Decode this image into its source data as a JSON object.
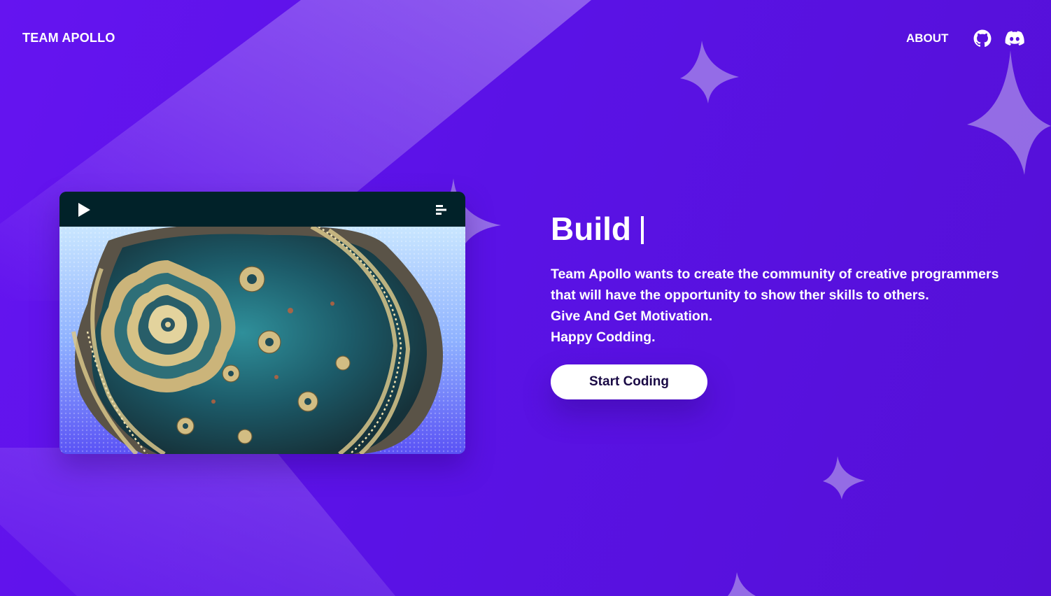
{
  "navbar": {
    "brand": "TEAM APOLLO",
    "about_label": "ABOUT",
    "github_icon": "github-icon",
    "discord_icon": "discord-icon"
  },
  "video": {
    "play_icon": "play-icon",
    "menu_icon": "menu-icon",
    "thumbnail": "mandelbulb-fractal-image"
  },
  "hero": {
    "title": "Build",
    "description_lines": [
      "Team Apollo wants to create the community of creative programmers that will have the opportunity to show ther skills to others.",
      "Give And Get Motivation.",
      "Happy Codding."
    ],
    "cta_label": "Start Coding"
  },
  "colors": {
    "background": "#5a12e6",
    "video_toolbar": "#012229",
    "button_bg": "#ffffff",
    "button_text": "#1a0a45"
  }
}
